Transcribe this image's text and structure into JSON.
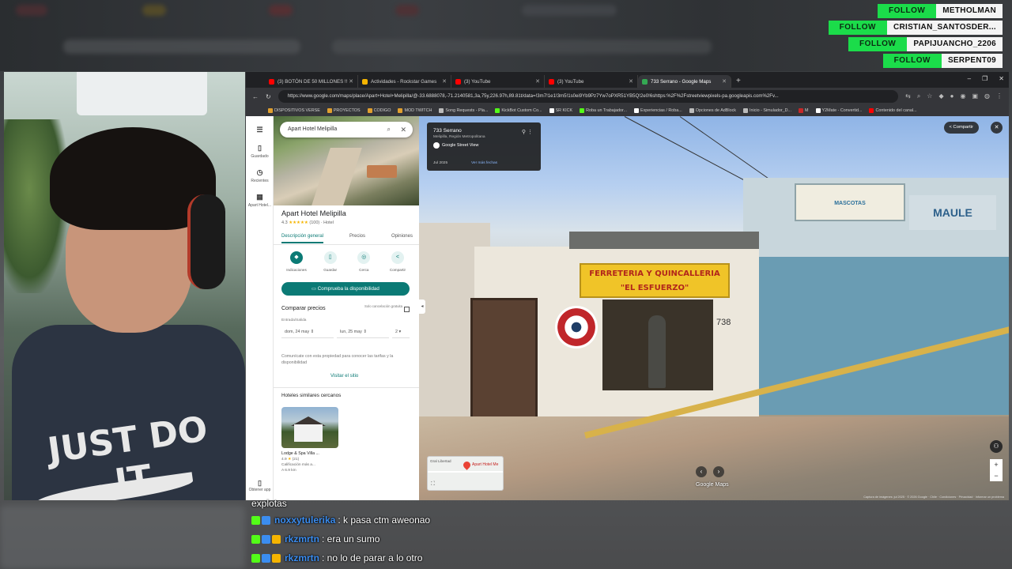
{
  "follows": [
    {
      "tag": "FOLLOW",
      "user": "METHOLMAN"
    },
    {
      "tag": "FOLLOW",
      "user": "CRISTIAN_SANTOSDER..."
    },
    {
      "tag": "FOLLOW",
      "user": "PAPIJUANCHO_2206"
    },
    {
      "tag": "FOLLOW",
      "user": "SERPENT09"
    }
  ],
  "webcam": {
    "shirt_text": "JUST DO IT"
  },
  "browser": {
    "tabs": [
      {
        "label": "(3) BOTÓN DE 50 MILLONES !!",
        "color": "#ff0000"
      },
      {
        "label": "Actividades - Rockstar Games",
        "color": "#f5b400"
      },
      {
        "label": "(3) YouTube",
        "color": "#ff0000"
      },
      {
        "label": "(3) YouTube",
        "color": "#ff0000"
      },
      {
        "label": "733 Serrano - Google Maps",
        "color": "#34a853"
      }
    ],
    "new_tab": "+",
    "url": "https://www.google.com/maps/place/Apart+Hotel+Melipilla/@-33.6888078,-71.2140581,3a,75y,226.97h,89.81t/data=!3m7!1e1!3m5!1s0ei9Yb9Pz7Yw7oPXR51YB5Q!2e0!6shttps:%2F%2Fstreetviewpixels-pa.googleapis.com%2Fv...",
    "bookmarks": [
      "DISPOSITIVOS VERSE",
      "PROYECTOS",
      "CODIGO",
      "MOD TWITCH",
      "Song Requests - Pla...",
      "KickBot Custom Co...",
      "SR KICK",
      "Roba un Trabajador...",
      "Experiencias / Roba...",
      "Opciones de AdBlock",
      "Inicio - Simulador_D...",
      "M",
      "Y2Mate - Convertid...",
      "Contenido del canal..."
    ]
  },
  "maps": {
    "rail": {
      "saved": "Guardado",
      "recent": "Recientes",
      "hotel": "Apart Hotel...",
      "get_app": "Obtener app"
    },
    "search_value": "Apart Hotel Melipilla",
    "place_name": "Apart Hotel Melipilla",
    "rating": "4.3",
    "stars": "★★★★★",
    "reviews": "(100)",
    "category": "· Hotel",
    "tabs": [
      "Descripción general",
      "Precios",
      "Opiniones"
    ],
    "actions": [
      {
        "label": "Indicaciones",
        "icon": "directions-icon"
      },
      {
        "label": "Guardar",
        "icon": "bookmark-icon"
      },
      {
        "label": "Cerca",
        "icon": "nearby-icon"
      },
      {
        "label": "Compartir",
        "icon": "share-icon"
      }
    ],
    "availability_btn": "Comprueba la disponibilidad",
    "compare_title": "Comparar precios",
    "compare_note": "Solo cancelación gratuita",
    "entry_label": "Entrada/Salida",
    "checkin": "dom, 24 may",
    "checkout": "lun, 25 may",
    "guests": "2",
    "contact_text": "Comunícate con esta propiedad para conocer las tarifas y la disponibilidad",
    "visit_site": "Visitar el sitio",
    "similar_title": "Hoteles similares cercanos",
    "similar_hotel": {
      "name": "Lodge & Spa Villa ...",
      "rating": "4.9",
      "stars": "★",
      "reviews": "(21)",
      "desc": "Calificación más a...",
      "distance": "A 6.9 km"
    }
  },
  "streetview": {
    "address": "733 Serrano",
    "region": "Melipilla, Región Metropolitana",
    "source": "Google Street View",
    "date": "Jul 2025",
    "more_dates": "Ver más fechas",
    "share": "Compartir",
    "shop_sign": "FERRETERIA Y QUINCALLERIA \"EL ESFUERZO\"",
    "door_number": "738",
    "wall_sign": "MAULE",
    "store_sign2": "MASCOTAS",
    "minimap_label": "Apart Hotel Me",
    "minimap_street": "Gral Libertad",
    "brand": "Google Maps",
    "footer": "Captura de imágenes: jul 2025 · © 2026 Google · Chile · Condiciones · Privacidad · Informar un problema"
  },
  "chat": [
    {
      "user": "",
      "text": "explotas"
    },
    {
      "user": "noxxytulerika",
      "text": ": k pasa ctm aweonao"
    },
    {
      "user": "rkzmrtn",
      "text": ": era un sumo"
    },
    {
      "user": "rkzmrtn",
      "text": ": no lo de parar a lo otro"
    }
  ],
  "colors": {
    "follow": "#1bdc4a",
    "maps_accent": "#0b7a75",
    "chat_user": "#3b8df0"
  }
}
